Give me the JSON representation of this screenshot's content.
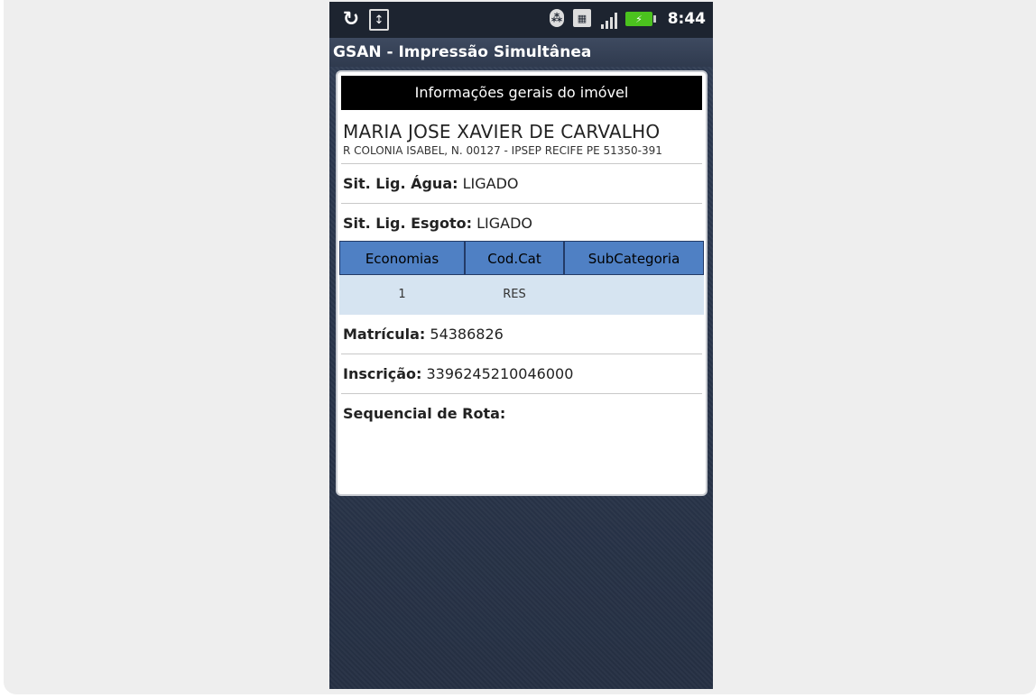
{
  "status_bar": {
    "time": "8:44",
    "icons": [
      "sync-icon",
      "usb-icon",
      "bluetooth-icon",
      "sdcard-icon",
      "signal-icon",
      "battery-charging-icon"
    ]
  },
  "app": {
    "title": "GSAN - Impressão Simultânea"
  },
  "card": {
    "header": "Informações gerais do imóvel",
    "owner_name": "MARIA JOSE XAVIER DE CARVALHO",
    "address": "R COLONIA ISABEL, N. 00127 - IPSEP RECIFE PE 51350-391",
    "sit_agua": {
      "label": "Sit. Lig. Água:",
      "value": "LIGADO"
    },
    "sit_esgoto": {
      "label": "Sit. Lig. Esgoto:",
      "value": "LIGADO"
    },
    "table": {
      "columns": [
        "Economias",
        "Cod.Cat",
        "SubCategoria"
      ],
      "rows": [
        [
          "1",
          "RES",
          ""
        ]
      ]
    },
    "matricula": {
      "label": "Matrícula:",
      "value": "54386826"
    },
    "inscricao": {
      "label": "Inscrição:",
      "value": "3396245210046000"
    },
    "sequencial": {
      "label": "Sequencial de Rota:",
      "value": ""
    }
  }
}
